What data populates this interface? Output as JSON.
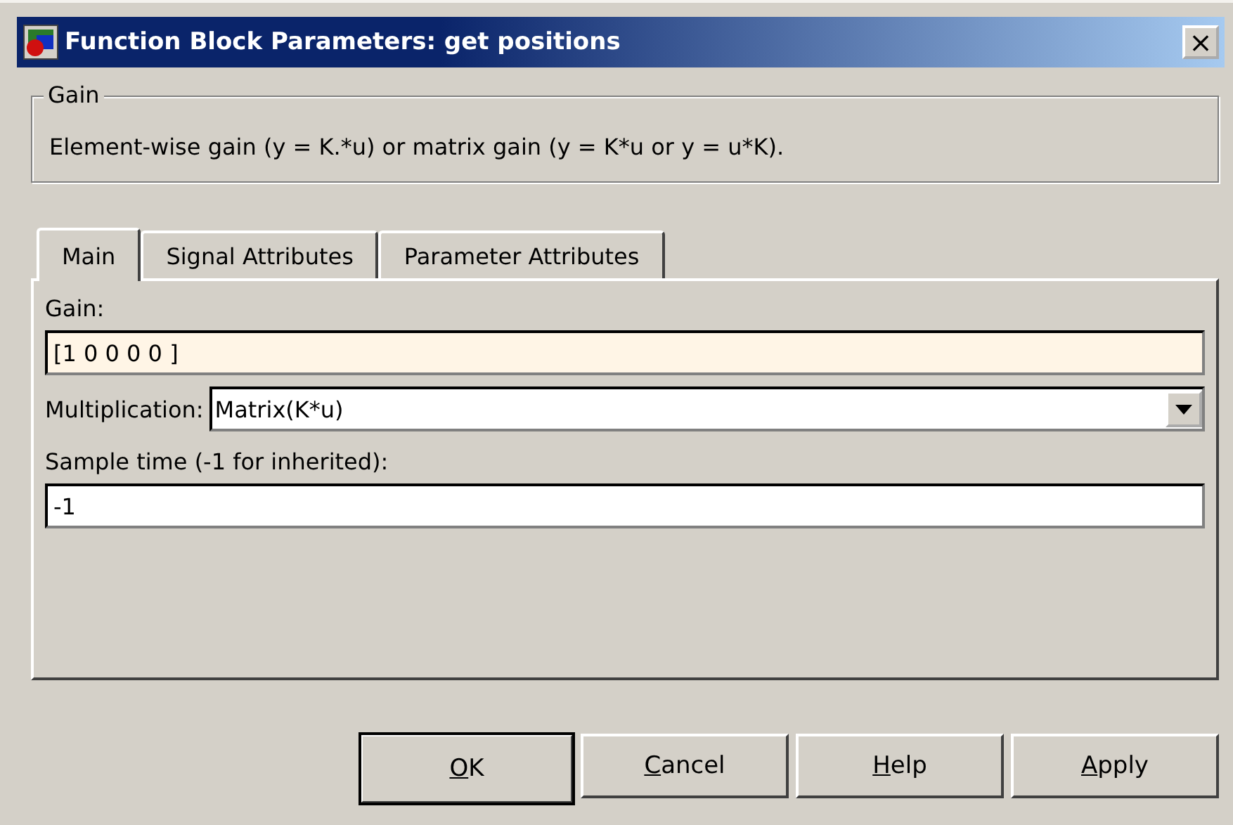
{
  "window": {
    "title": "Function Block Parameters: get positions",
    "close_label": "×"
  },
  "group": {
    "title": "Gain",
    "description": "Element-wise gain (y = K.*u) or matrix gain (y = K*u or y = u*K)."
  },
  "tabs": [
    {
      "label": "Main",
      "selected": true
    },
    {
      "label": "Signal Attributes",
      "selected": false
    },
    {
      "label": "Parameter Attributes",
      "selected": false
    }
  ],
  "fields": [
    {
      "kind": "text",
      "label": "Gain:",
      "value": "[1 0 0 0 0 ]",
      "focused": true
    },
    {
      "kind": "select",
      "label": "Multiplication:",
      "value": "Matrix(K*u)",
      "focused": false
    },
    {
      "kind": "text",
      "label": "Sample time (-1 for inherited):",
      "value": "-1",
      "focused": false
    }
  ],
  "buttons": [
    {
      "parts": [
        {
          "text": "O",
          "underlined": true
        },
        {
          "text": "K",
          "underlined": false
        }
      ],
      "default": true
    },
    {
      "parts": [
        {
          "text": "C",
          "underlined": true
        },
        {
          "text": "ancel",
          "underlined": false
        }
      ],
      "default": false
    },
    {
      "parts": [
        {
          "text": "H",
          "underlined": true
        },
        {
          "text": "elp",
          "underlined": false
        }
      ],
      "default": false
    },
    {
      "parts": [
        {
          "text": "A",
          "underlined": true
        },
        {
          "text": "pply",
          "underlined": false
        }
      ],
      "default": false
    }
  ]
}
